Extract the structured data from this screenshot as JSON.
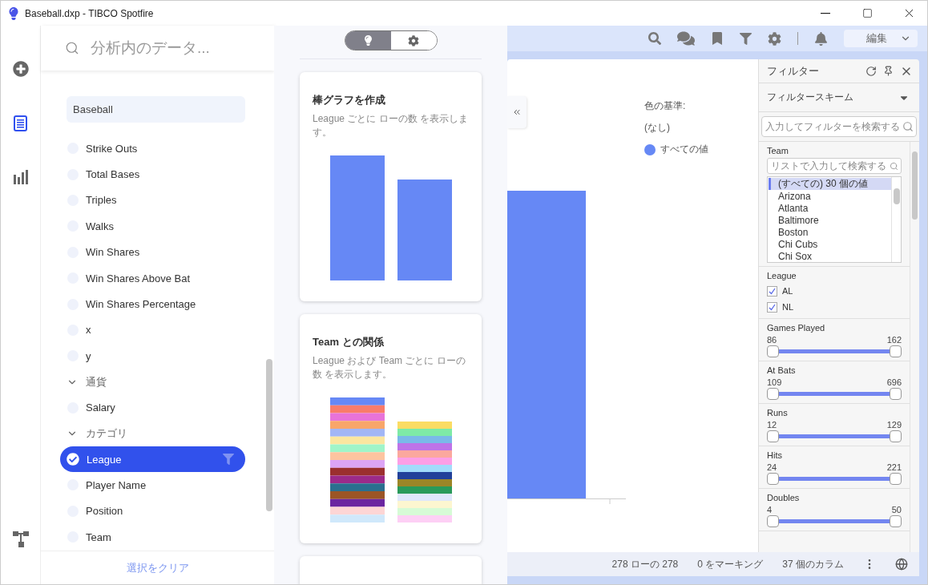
{
  "window": {
    "title": "Baseball.dxp - TIBCO Spotfire"
  },
  "rail": [
    {
      "kind": "add",
      "selected": false
    },
    {
      "kind": "data",
      "selected": true
    },
    {
      "kind": "viz",
      "selected": false
    },
    {
      "kind": "flow",
      "selected": false
    }
  ],
  "data_panel": {
    "search": {
      "placeholder": "分析内のデータ..."
    },
    "source": "Baseball",
    "items": [
      {
        "label": "Strike Outs",
        "selected": false
      },
      {
        "label": "Total Bases",
        "selected": false
      },
      {
        "label": "Triples",
        "selected": false
      },
      {
        "label": "Walks",
        "selected": false
      },
      {
        "label": "Win Shares",
        "selected": false
      },
      {
        "label": "Win Shares Above Bat",
        "selected": false
      },
      {
        "label": "Win Shares Percentage",
        "selected": false
      },
      {
        "label": "x",
        "selected": false
      },
      {
        "label": "y",
        "selected": false
      }
    ],
    "groups": [
      {
        "label": "通貨",
        "expanded": true,
        "children": [
          {
            "label": "Salary",
            "selected": false
          }
        ]
      },
      {
        "label": "カテゴリ",
        "expanded": true,
        "children": [
          {
            "label": "League",
            "selected": true
          },
          {
            "label": "Player Name",
            "selected": false
          },
          {
            "label": "Position",
            "selected": false
          },
          {
            "label": "Team",
            "selected": false
          }
        ]
      }
    ],
    "clear": "選択をクリア"
  },
  "recommendations": {
    "modes": [
      {
        "kind": "bulb",
        "selected": true
      },
      {
        "kind": "gear",
        "selected": false
      }
    ],
    "cards": [
      {
        "kind": "bar",
        "title": "棒グラフを作成",
        "description": "League ごとに ローの数 を表示します。"
      },
      {
        "kind": "stacked",
        "title": "Team との関係",
        "description": "League および Team ごとに ローの数 を表示します。"
      },
      {
        "kind": "blank"
      }
    ]
  },
  "toolbar": {
    "icons": [
      {
        "kind": "search"
      },
      {
        "kind": "comments"
      },
      {
        "kind": "bookmark"
      },
      {
        "kind": "filter"
      },
      {
        "kind": "settings"
      },
      {
        "kind": "separator"
      },
      {
        "kind": "bell"
      }
    ],
    "menu": "編集"
  },
  "visualization": {
    "legend": {
      "title": "色の基準:",
      "subtitle": "(なし)",
      "entries": [
        {
          "label": "すべての値",
          "color": "#6688f5"
        }
      ]
    }
  },
  "filters": {
    "title": "フィルター",
    "scheme": "フィルタースキーム",
    "search": {
      "placeholder": "入力してフィルターを検索する"
    },
    "sections": [
      {
        "kind": "list",
        "name": "Team",
        "search": {
          "placeholder": "リストで入力して検索する"
        },
        "values": [
          {
            "label": "(すべての) 30 個の値",
            "selected": true
          },
          {
            "label": "Arizona",
            "selected": false
          },
          {
            "label": "Atlanta",
            "selected": false
          },
          {
            "label": "Baltimore",
            "selected": false
          },
          {
            "label": "Boston",
            "selected": false
          },
          {
            "label": "Chi Cubs",
            "selected": false
          },
          {
            "label": "Chi Sox",
            "selected": false
          }
        ]
      },
      {
        "kind": "checkboxes",
        "name": "League",
        "options": [
          {
            "label": "AL",
            "checked": true
          },
          {
            "label": "NL",
            "checked": true
          }
        ]
      },
      {
        "kind": "range",
        "name": "Games Played",
        "min": "86",
        "max": "162",
        "level": 1
      },
      {
        "kind": "range",
        "name": "At Bats",
        "min": "109",
        "max": "696",
        "level": 1
      },
      {
        "kind": "range",
        "name": "Runs",
        "min": "12",
        "max": "129",
        "level": 1
      },
      {
        "kind": "range",
        "name": "Hits",
        "min": "24",
        "max": "221",
        "level": 1
      },
      {
        "kind": "range",
        "name": "Doubles",
        "min": "4",
        "max": "50",
        "level": 1
      }
    ]
  },
  "status_bar": [
    "278 ローの 278",
    "0 をマーキング",
    "37 個のカラム"
  ]
}
